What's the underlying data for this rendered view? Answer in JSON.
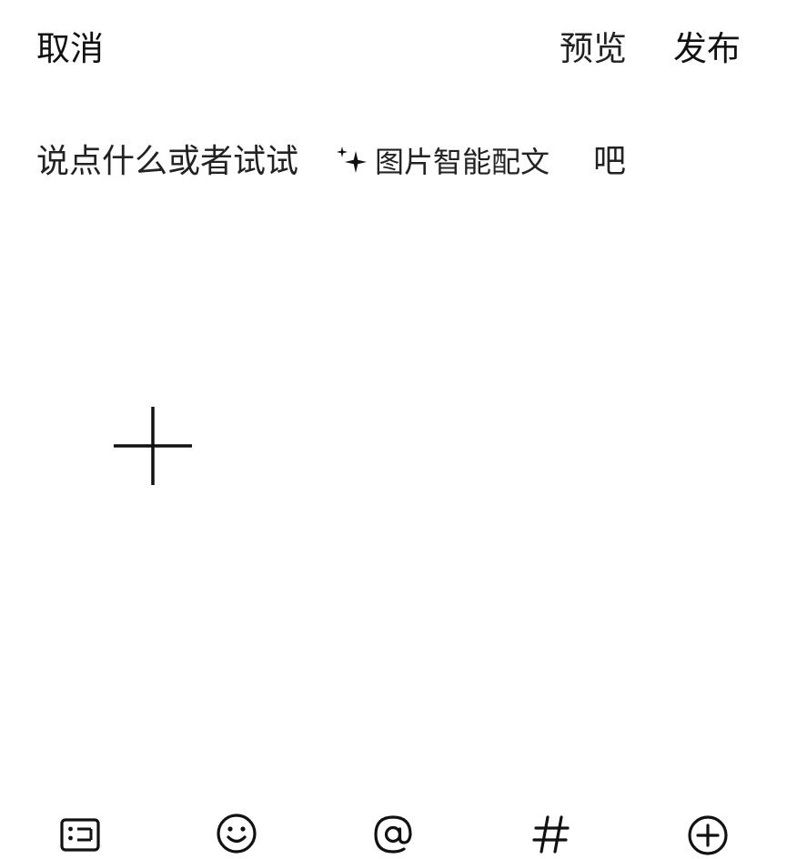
{
  "header": {
    "cancel_label": "取消",
    "preview_label": "预览",
    "publish_label": "发布"
  },
  "composer": {
    "placeholder_before": "说点什么或者试试",
    "ai_button_icon": "sparkle-icon",
    "ai_button_label": "图片智能配文",
    "placeholder_after": "吧"
  },
  "media": {
    "add_icon": "plus-icon"
  },
  "toolbar": {
    "items": [
      {
        "icon": "image-text-icon"
      },
      {
        "icon": "emoji-icon"
      },
      {
        "icon": "at-mention-icon"
      },
      {
        "icon": "hashtag-icon"
      },
      {
        "icon": "add-circle-icon"
      }
    ]
  }
}
